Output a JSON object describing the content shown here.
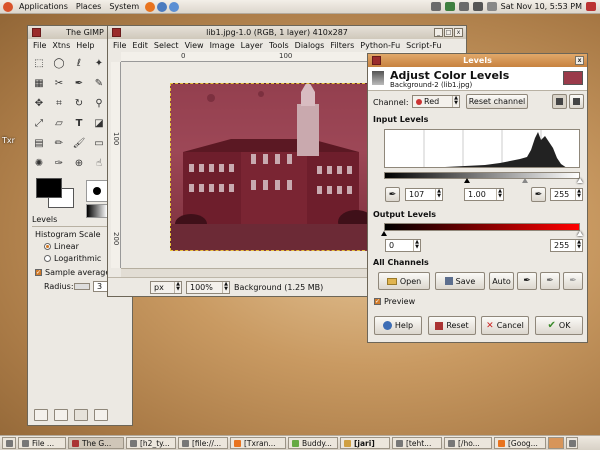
{
  "top_panel": {
    "menus": [
      "Applications",
      "Places",
      "System"
    ],
    "clock": "Sat Nov 10,  5:53 PM"
  },
  "toolbox": {
    "title": "The GIMP",
    "menu": [
      "File",
      "Xtns",
      "Help"
    ],
    "levels_tab": "Levels",
    "histogram_scale_label": "Histogram Scale",
    "linear_label": "Linear",
    "log_label": "Logarithmic",
    "sample_average_label": "Sample average",
    "radius_label": "Radius:",
    "radius_value": "3"
  },
  "image_window": {
    "title": "lib1.jpg-1.0 (RGB, 1 layer) 410x287",
    "menu": [
      "File",
      "Edit",
      "Select",
      "View",
      "Image",
      "Layer",
      "Tools",
      "Dialogs",
      "Filters",
      "Python-Fu",
      "Script-Fu"
    ],
    "unit": "px",
    "zoom": "100%",
    "status": "Background (1.25 MB)",
    "ruler_marks": [
      "0",
      "100",
      "200",
      "300"
    ]
  },
  "levels": {
    "title": "Levels",
    "header_title": "Adjust Color Levels",
    "header_sub": "Background-2 (lib1.jpg)",
    "channel_label": "Channel:",
    "channel_value": "Red",
    "reset_channel": "Reset channel",
    "input_levels": "Input Levels",
    "input_low": "107",
    "input_gamma": "1.00",
    "input_high": "255",
    "output_levels": "Output Levels",
    "output_low": "0",
    "output_high": "255",
    "all_channels": "All Channels",
    "open": "Open",
    "save": "Save",
    "auto": "Auto",
    "preview": "Preview",
    "help": "Help",
    "reset": "Reset",
    "cancel": "Cancel",
    "ok": "OK"
  },
  "desktop": {
    "icon_label": "Txr"
  },
  "taskbar": [
    {
      "label": "File ..."
    },
    {
      "label": "The G..."
    },
    {
      "label": "[h2_ty..."
    },
    {
      "label": "[file://..."
    },
    {
      "label": "[Txran..."
    },
    {
      "label": "Buddy..."
    },
    {
      "label": "[jari]"
    },
    {
      "label": "[teht..."
    },
    {
      "label": "[/ho..."
    },
    {
      "label": "[Goog..."
    }
  ],
  "colors": {
    "accent": "#d08a45",
    "image_tint": "#9e3a4c",
    "output_red": "#ff0000"
  }
}
